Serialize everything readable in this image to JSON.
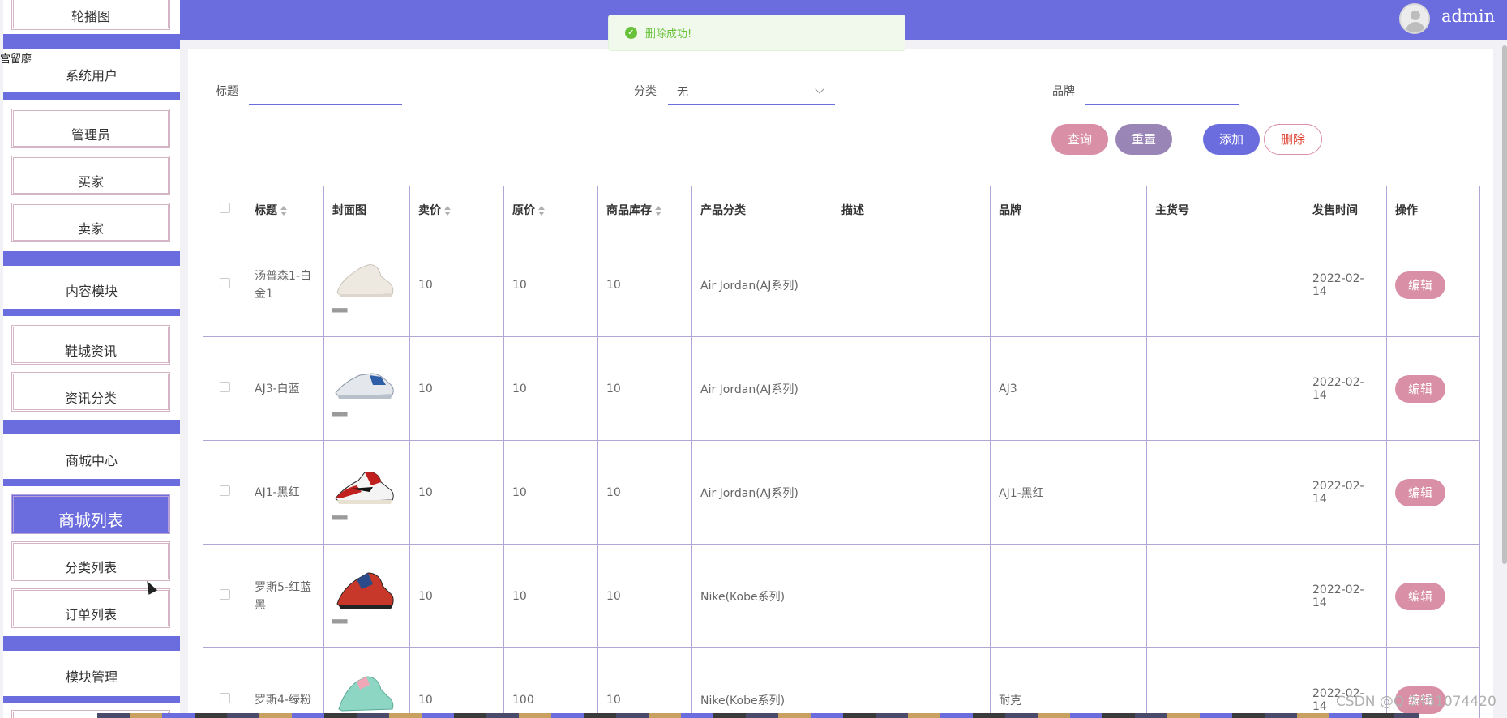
{
  "header": {
    "username": "admin"
  },
  "toast": {
    "message": "删除成功!",
    "icon": "check-circle-icon",
    "color": "#67c23a"
  },
  "sidebar": {
    "stray_text": "宫留廖",
    "top_item": "轮播图",
    "groups": [
      {
        "title": "系统用户",
        "items": [
          "管理员",
          "买家",
          "卖家"
        ]
      },
      {
        "title": "内容模块",
        "items": [
          "鞋城资讯",
          "资讯分类"
        ]
      },
      {
        "title": "商城中心",
        "items": [
          "商城列表",
          "分类列表",
          "订单列表"
        ]
      },
      {
        "title": "模块管理",
        "items": []
      }
    ],
    "active_item": "商城列表",
    "accent_color": "#6b6cdd"
  },
  "search": {
    "title_label": "标题",
    "title_value": "",
    "category_label": "分类",
    "category_value": "无",
    "brand_label": "品牌",
    "brand_value": ""
  },
  "buttons": {
    "query": "查询",
    "reset": "重置",
    "add": "添加",
    "delete": "删除"
  },
  "table": {
    "columns": [
      "标题",
      "封面图",
      "卖价",
      "原价",
      "商品库存",
      "产品分类",
      "描述",
      "品牌",
      "主货号",
      "发售时间",
      "操作"
    ],
    "rows": [
      {
        "title": "汤普森1-白金1",
        "price": "10",
        "original_price": "10",
        "stock": "10",
        "category": "Air Jordan(AJ系列)",
        "description": "",
        "brand": "",
        "sku": "",
        "release_date": "2022-02-14",
        "action": "编辑",
        "image": "white-sneaker"
      },
      {
        "title": "AJ3-白蓝",
        "price": "10",
        "original_price": "10",
        "stock": "10",
        "category": "Air Jordan(AJ系列)",
        "description": "",
        "brand": "AJ3",
        "sku": "",
        "release_date": "2022-02-14",
        "action": "编辑",
        "image": "white-blue-sneaker"
      },
      {
        "title": "AJ1-黑红",
        "price": "10",
        "original_price": "10",
        "stock": "10",
        "category": "Air Jordan(AJ系列)",
        "description": "",
        "brand": "AJ1-黑红",
        "sku": "",
        "release_date": "2022-02-14",
        "action": "编辑",
        "image": "black-red-sneaker"
      },
      {
        "title": "罗斯5-红蓝黑",
        "price": "10",
        "original_price": "10",
        "stock": "10",
        "category": "Nike(Kobe系列)",
        "description": "",
        "brand": "",
        "sku": "",
        "release_date": "2022-02-14",
        "action": "编辑",
        "image": "red-blue-sneaker"
      },
      {
        "title": "罗斯4-绿粉",
        "price": "10",
        "original_price": "100",
        "stock": "10",
        "category": "Nike(Kobe系列)",
        "description": "",
        "brand": "耐克",
        "sku": "",
        "release_date": "2022-02-14",
        "action": "编辑",
        "image": "green-pink-sneaker"
      }
    ]
  },
  "watermark": "CSDN @Q 3461074420"
}
